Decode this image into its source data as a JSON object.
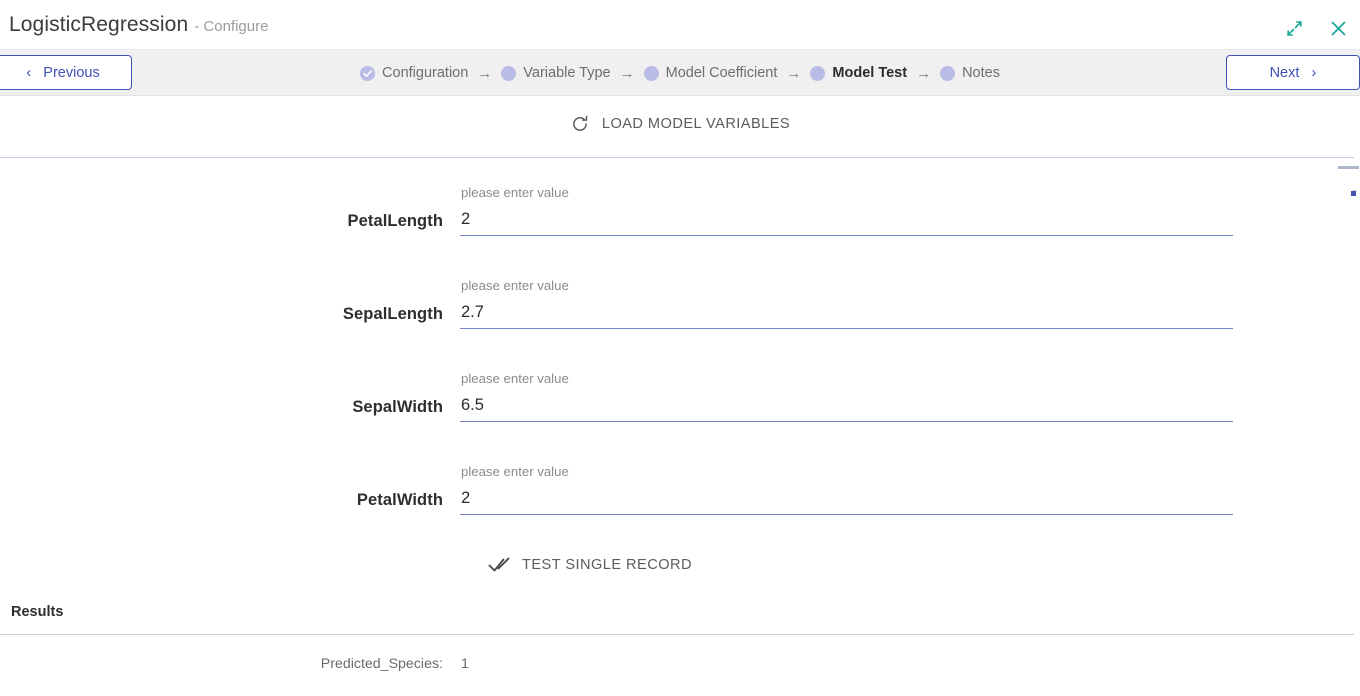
{
  "window": {
    "title": "LogisticRegression",
    "subtitle": "- Configure",
    "minimize_icon": "collapse-arrows-icon",
    "close_icon": "close-x-icon",
    "accent_teal": "#1aa79a",
    "accent_indigo": "#3f51b5"
  },
  "toolbar": {
    "previous_label": "Previous",
    "next_label": "Next",
    "prev_chevron": "‹",
    "next_chevron": "›",
    "steps": [
      {
        "label": "Configuration",
        "state": "complete",
        "icon": "check-circle-icon"
      },
      {
        "label": "Variable Type",
        "state": "pending",
        "icon": "dot-icon"
      },
      {
        "label": "Model Coefficient",
        "state": "pending",
        "icon": "dot-icon"
      },
      {
        "label": "Model Test",
        "state": "active",
        "icon": "dot-icon"
      },
      {
        "label": "Notes",
        "state": "pending",
        "icon": "dot-icon"
      }
    ],
    "step_arrow": "→"
  },
  "main": {
    "load_model_variables_label": "LOAD MODEL VARIABLES",
    "load_icon": "refresh-icon",
    "test_single_record_label": "TEST SINGLE RECORD",
    "test_icon": "double-check-icon",
    "fields": [
      {
        "label": "PetalLength",
        "placeholder": "please enter value",
        "value": "2"
      },
      {
        "label": "SepalLength",
        "placeholder": "please enter value",
        "value": "2.7"
      },
      {
        "label": "SepalWidth",
        "placeholder": "please enter value",
        "value": "6.5"
      },
      {
        "label": "PetalWidth",
        "placeholder": "please enter value",
        "value": "2"
      }
    ],
    "results": {
      "title": "Results",
      "rows": [
        {
          "key": "Predicted_Species:",
          "value": "1"
        }
      ]
    }
  }
}
